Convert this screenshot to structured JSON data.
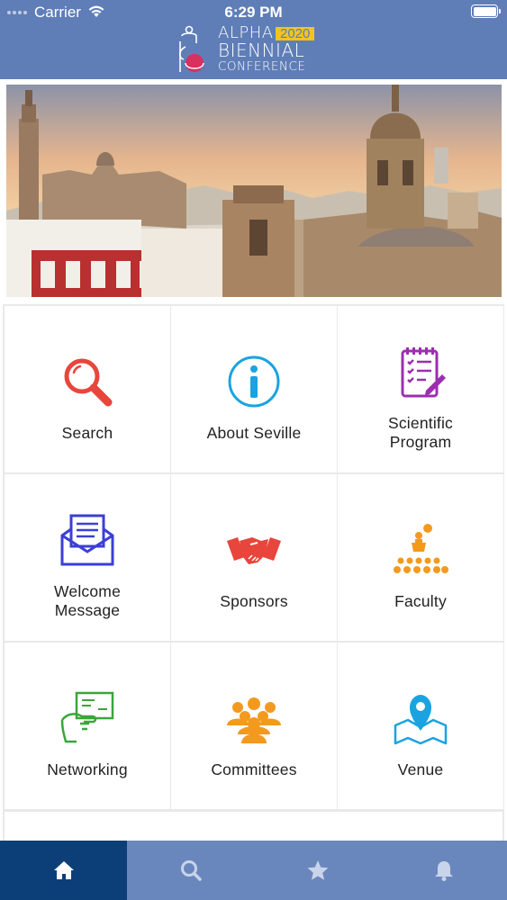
{
  "status_bar": {
    "carrier": "Carrier",
    "time": "6:29 PM"
  },
  "header": {
    "logo": {
      "line1": "ALPHA",
      "year": "2020",
      "line2": "BIENNIAL",
      "line3": "CONFERENCE"
    }
  },
  "colors": {
    "header": "#5f7eb7",
    "tabbar": "#6a87bd",
    "tab_active": "#0c3f78",
    "search": "#e8453c",
    "about": "#1aa3e0",
    "program": "#9b2fae",
    "welcome": "#3b3fd6",
    "sponsors": "#e8453c",
    "faculty": "#f39a1e",
    "networking": "#3aa63a",
    "committees": "#f39a1e",
    "venue": "#1aa3e0"
  },
  "menu": [
    {
      "label": "Search",
      "icon": "magnifier-icon"
    },
    {
      "label": "About Seville",
      "icon": "info-icon"
    },
    {
      "label": "Scientific Program",
      "line1": "Scientific",
      "line2": "Program",
      "icon": "notepad-icon"
    },
    {
      "label": "Welcome Message",
      "line1": "Welcome",
      "line2": "Message",
      "icon": "envelope-icon"
    },
    {
      "label": "Sponsors",
      "icon": "handshake-icon"
    },
    {
      "label": "Faculty",
      "icon": "speaker-audience-icon"
    },
    {
      "label": "Networking",
      "icon": "business-card-icon"
    },
    {
      "label": "Committees",
      "icon": "group-icon"
    },
    {
      "label": "Venue",
      "icon": "map-pin-icon"
    }
  ],
  "tabs": [
    {
      "name": "home",
      "icon": "home-icon",
      "active": true
    },
    {
      "name": "search",
      "icon": "search-icon",
      "active": false
    },
    {
      "name": "favorites",
      "icon": "star-icon",
      "active": false
    },
    {
      "name": "notifications",
      "icon": "bell-icon",
      "active": false
    }
  ]
}
